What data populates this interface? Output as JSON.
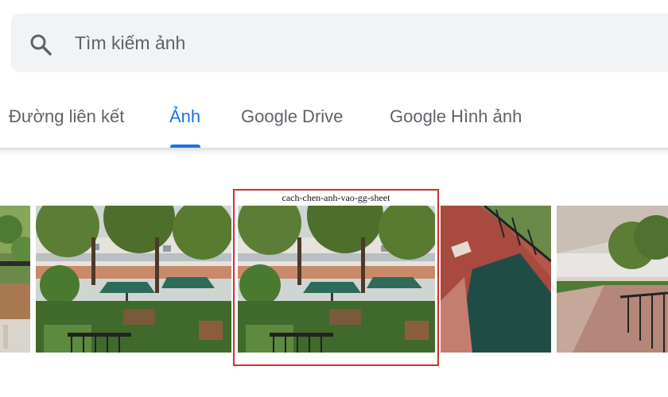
{
  "search": {
    "placeholder": "Tìm kiếm ảnh",
    "icon": "search-icon"
  },
  "tabs": [
    {
      "label": "Đường liên kết",
      "active": false
    },
    {
      "label": "Ảnh",
      "active": true
    },
    {
      "label": "Google Drive",
      "active": false
    },
    {
      "label": "Google Hình ảnh",
      "active": false
    }
  ],
  "photos": {
    "selected_caption": "cach-chen-anh-vao-gg-sheet",
    "selection_color": "#d32f2f"
  },
  "colors": {
    "accent": "#1a73e8",
    "tab_text": "#5f6368",
    "search_bg": "#f1f3f4"
  }
}
